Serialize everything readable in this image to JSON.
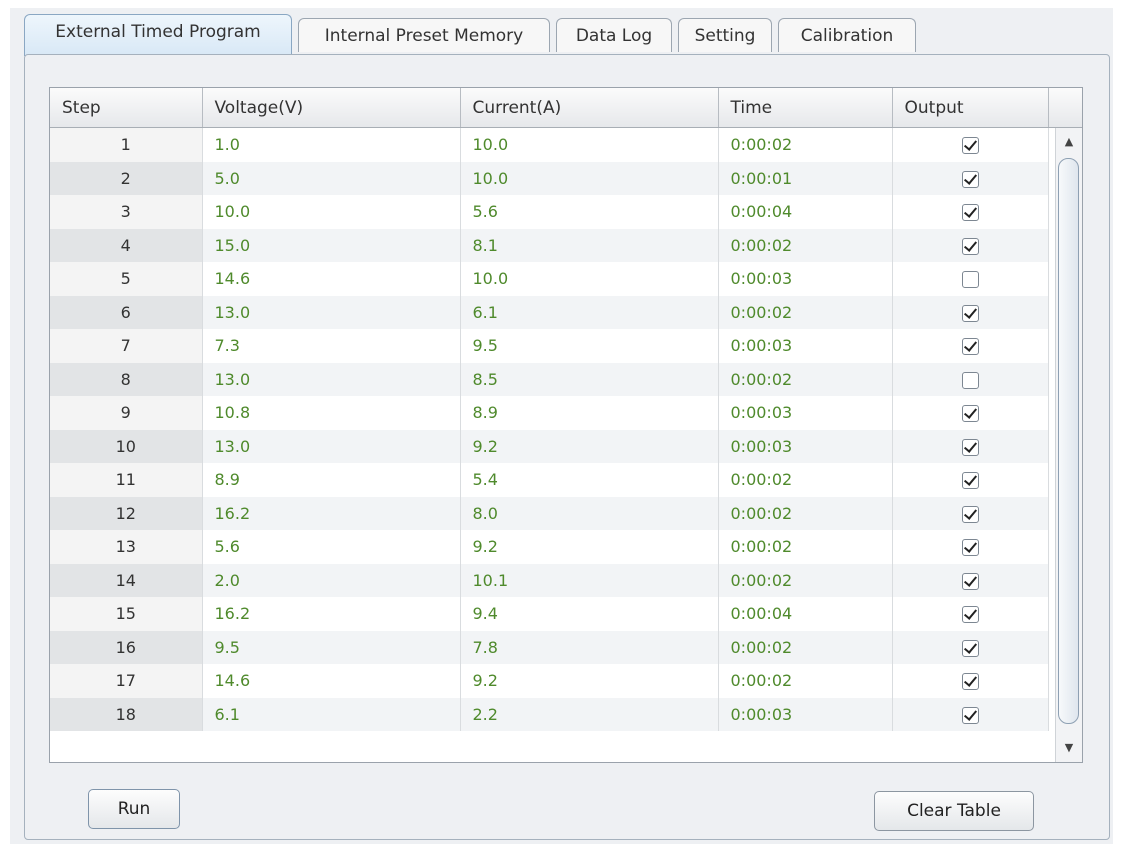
{
  "tabs": [
    {
      "label": "External Timed Program",
      "active": true
    },
    {
      "label": "Internal Preset Memory",
      "active": false
    },
    {
      "label": "Data Log",
      "active": false
    },
    {
      "label": "Setting",
      "active": false
    },
    {
      "label": "Calibration",
      "active": false
    }
  ],
  "table": {
    "columns": [
      "Step",
      "Voltage(V)",
      "Current(A)",
      "Time",
      "Output"
    ],
    "rows": [
      {
        "step": "1",
        "voltage": "1.0",
        "current": "10.0",
        "time": "0:00:02",
        "output": true
      },
      {
        "step": "2",
        "voltage": "5.0",
        "current": "10.0",
        "time": "0:00:01",
        "output": true
      },
      {
        "step": "3",
        "voltage": "10.0",
        "current": "5.6",
        "time": "0:00:04",
        "output": true
      },
      {
        "step": "4",
        "voltage": "15.0",
        "current": "8.1",
        "time": "0:00:02",
        "output": true
      },
      {
        "step": "5",
        "voltage": "14.6",
        "current": "10.0",
        "time": "0:00:03",
        "output": false
      },
      {
        "step": "6",
        "voltage": "13.0",
        "current": "6.1",
        "time": "0:00:02",
        "output": true
      },
      {
        "step": "7",
        "voltage": "7.3",
        "current": "9.5",
        "time": "0:00:03",
        "output": true
      },
      {
        "step": "8",
        "voltage": "13.0",
        "current": "8.5",
        "time": "0:00:02",
        "output": false
      },
      {
        "step": "9",
        "voltage": "10.8",
        "current": "8.9",
        "time": "0:00:03",
        "output": true
      },
      {
        "step": "10",
        "voltage": "13.0",
        "current": "9.2",
        "time": "0:00:03",
        "output": true
      },
      {
        "step": "11",
        "voltage": "8.9",
        "current": "5.4",
        "time": "0:00:02",
        "output": true
      },
      {
        "step": "12",
        "voltage": "16.2",
        "current": "8.0",
        "time": "0:00:02",
        "output": true
      },
      {
        "step": "13",
        "voltage": "5.6",
        "current": "9.2",
        "time": "0:00:02",
        "output": true
      },
      {
        "step": "14",
        "voltage": "2.0",
        "current": "10.1",
        "time": "0:00:02",
        "output": true
      },
      {
        "step": "15",
        "voltage": "16.2",
        "current": "9.4",
        "time": "0:00:04",
        "output": true
      },
      {
        "step": "16",
        "voltage": "9.5",
        "current": "7.8",
        "time": "0:00:02",
        "output": true
      },
      {
        "step": "17",
        "voltage": "14.6",
        "current": "9.2",
        "time": "0:00:02",
        "output": true
      },
      {
        "step": "18",
        "voltage": "6.1",
        "current": "2.2",
        "time": "0:00:03",
        "output": true
      }
    ]
  },
  "buttons": {
    "run_label": "Run",
    "clear_label": "Clear Table"
  },
  "colors": {
    "value_text": "#4f8a2c",
    "active_tab": "#d8e8f6"
  },
  "icons": {
    "scroll_up": "triangle-up-icon",
    "scroll_down": "triangle-down-icon"
  }
}
